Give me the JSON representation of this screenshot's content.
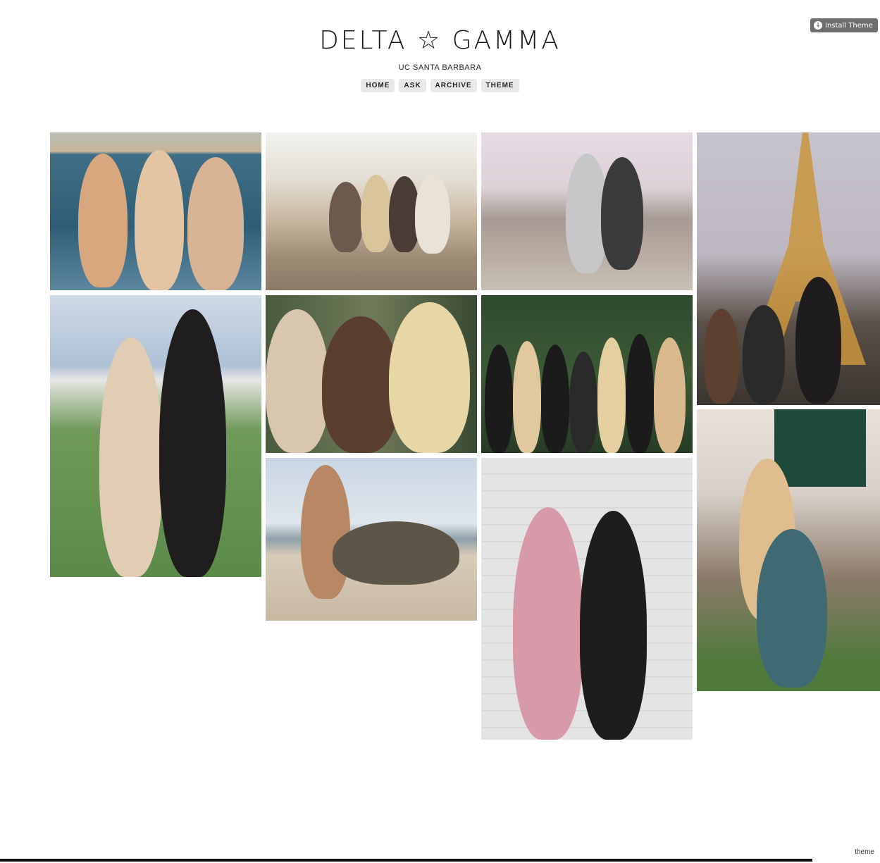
{
  "install_button": {
    "label": "Install Theme",
    "icon": "download-icon"
  },
  "header": {
    "title": "DELTA ☆ GAMMA",
    "subtitle": "UC SANTA BARBARA"
  },
  "nav": [
    "HOME",
    "ASK",
    "ARCHIVE",
    "THEME"
  ],
  "photos": [
    {
      "name": "photo-boat-trio"
    },
    {
      "name": "photo-city-overlook-group"
    },
    {
      "name": "photo-city-overlook-pair"
    },
    {
      "name": "photo-eiffel-tower"
    },
    {
      "name": "photo-golf-course-pair"
    },
    {
      "name": "photo-selfie-trio"
    },
    {
      "name": "photo-group-seven"
    },
    {
      "name": "photo-beach-pair"
    },
    {
      "name": "photo-wall-pair"
    },
    {
      "name": "photo-bid-day"
    }
  ],
  "footer": {
    "theme_link": "theme"
  }
}
